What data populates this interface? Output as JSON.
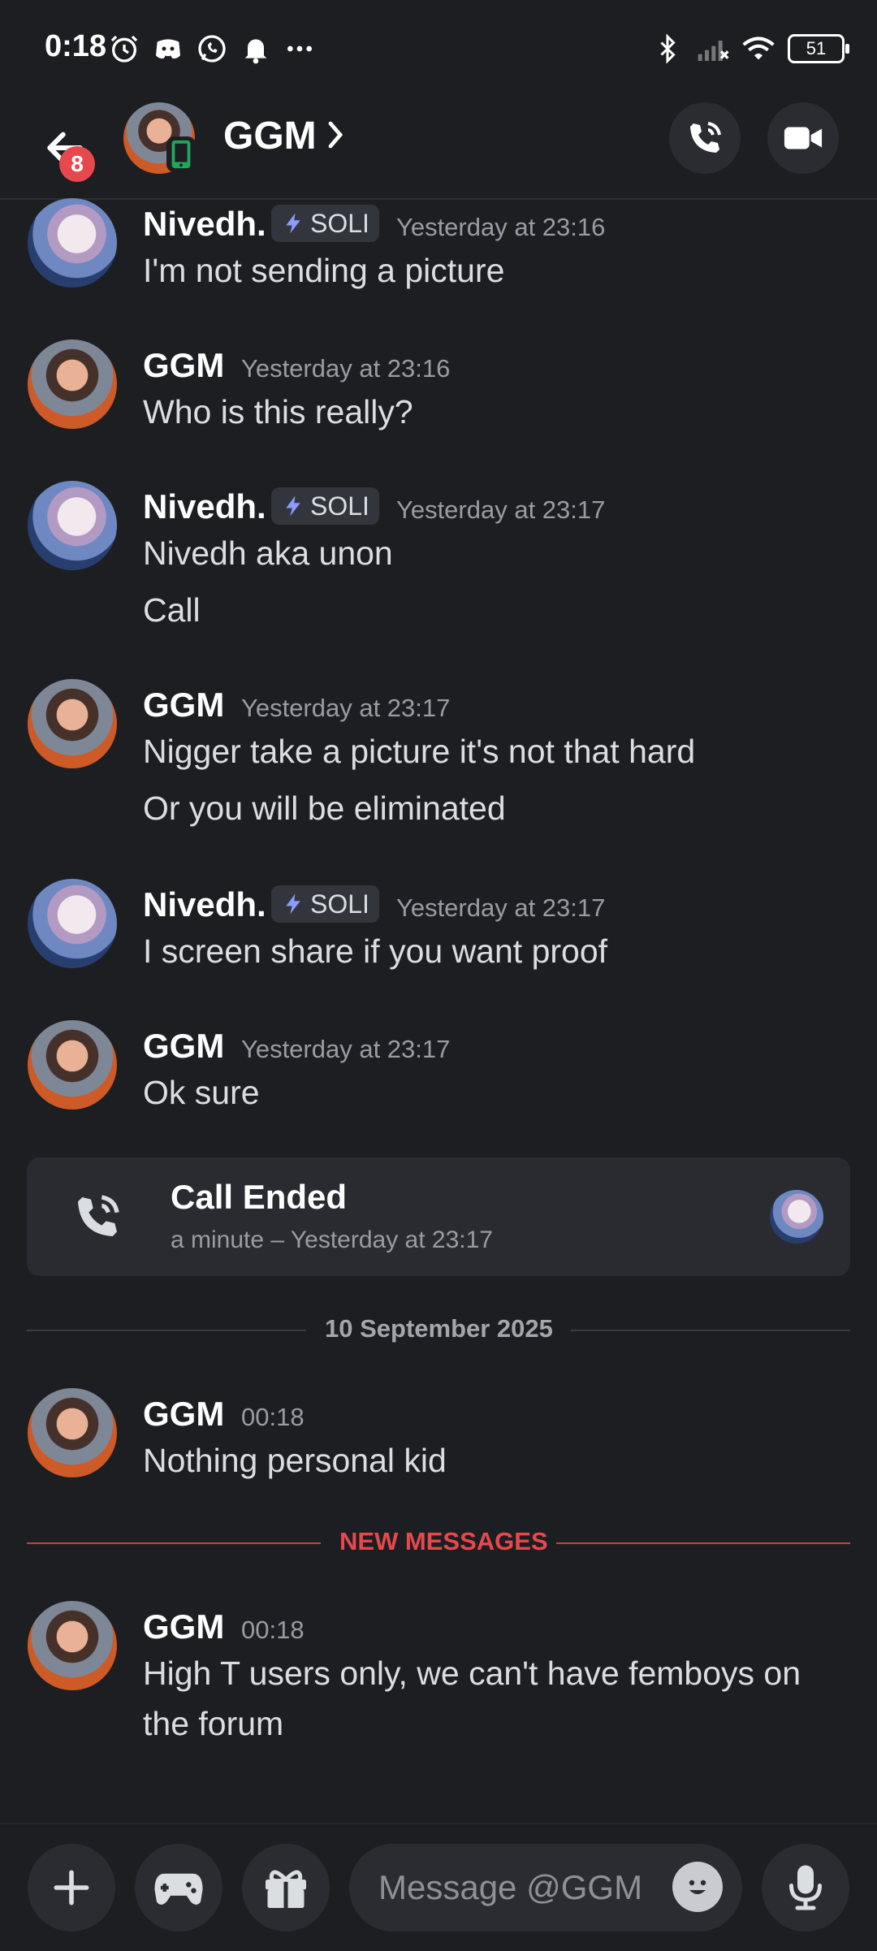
{
  "status_bar": {
    "time": "0:18",
    "icons": [
      "alarm-icon",
      "discord-icon",
      "whatsapp-icon",
      "bell-icon",
      "more-icon"
    ],
    "right_icons": [
      "bluetooth-icon",
      "signal-icon",
      "wifi-icon"
    ],
    "battery": "51"
  },
  "header": {
    "title": "GGM",
    "unread_badge": "8",
    "icons": [
      "back-arrow-icon",
      "chevron-right-icon",
      "phone-icon",
      "video-icon"
    ]
  },
  "messages": [
    {
      "author": "Nivedh.",
      "tag": "SOLI",
      "time": "Yesterday at 23:16",
      "lines": [
        "I'm not sending a picture"
      ]
    },
    {
      "author": "GGM",
      "time": "Yesterday at 23:16",
      "lines": [
        "Who is this really?"
      ]
    },
    {
      "author": "Nivedh.",
      "tag": "SOLI",
      "time": "Yesterday at 23:17",
      "lines": [
        "Nivedh aka unon",
        "Call"
      ]
    },
    {
      "author": "GGM",
      "time": "Yesterday at 23:17",
      "lines": [
        "Nigger take a picture it's not that hard",
        "Or you will be eliminated"
      ]
    },
    {
      "author": "Nivedh.",
      "tag": "SOLI",
      "time": "Yesterday at 23:17",
      "lines": [
        "I screen share if you want proof"
      ]
    },
    {
      "author": "GGM",
      "time": "Yesterday at 23:17",
      "lines": [
        "Ok sure"
      ]
    },
    {
      "author": "GGM",
      "time": "00:18",
      "lines": [
        "Nothing personal kid"
      ]
    },
    {
      "author": "GGM",
      "time": "00:18",
      "lines": [
        "High T users only, we can't have femboys on",
        "the forum"
      ]
    }
  ],
  "call_card": {
    "title": "Call Ended",
    "subtitle": "a minute – Yesterday at 23:17"
  },
  "date_divider": "10 September 2025",
  "new_messages_label": "NEW MESSAGES",
  "composer": {
    "placeholder": "Message @GGM",
    "buttons": [
      "plus-icon",
      "gamepad-icon",
      "gift-icon",
      "emoji-icon",
      "microphone-icon"
    ]
  },
  "colors": {
    "background": "#1d1e22",
    "accent_red": "#e5484d",
    "online_green": "#23a55a",
    "bolt_blue": "#8b9cff"
  }
}
